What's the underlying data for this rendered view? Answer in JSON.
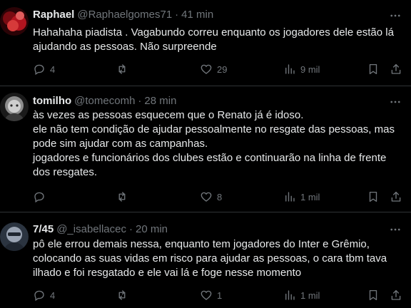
{
  "tweets": [
    {
      "name": "Raphael",
      "handle": "@Raphaelgomes71",
      "time": "41 min",
      "lines": [
        "Hahahaha piadista . Vagabundo correu enquanto os jogadores dele estão lá",
        "ajudando as pessoas. Não surpreende"
      ],
      "replies": "4",
      "reposts": "",
      "likes": "29",
      "views": "9 mil",
      "avatar_colors": [
        "#7a0b12",
        "#d63a3a"
      ]
    },
    {
      "name": "tomilho",
      "handle": "@tomecomh",
      "time": "28 min",
      "lines": [
        "às vezes as pessoas esquecem que o Renato já é idoso.",
        "ele não tem condição de ajudar pessoalmente no resgate das pessoas, mas",
        "pode sim ajudar com as campanhas.",
        "jogadores e funcionários dos clubes estão e continuarão na linha de frente",
        "dos resgates."
      ],
      "replies": "",
      "reposts": "",
      "likes": "8",
      "views": "1 mil",
      "avatar_colors": [
        "#cfcfcf",
        "#3a3a3a"
      ]
    },
    {
      "name": "7/45",
      "handle": "@_isabellacec",
      "time": "20 min",
      "lines": [
        "pô ele errou demais nessa, enquanto tem jogadores do Inter e Grêmio,",
        "colocando as suas vidas em risco para ajudar as pessoas, o cara tbm tava",
        "ilhado e foi resgatado e ele vai lá e foge nesse momento"
      ],
      "replies": "4",
      "reposts": "",
      "likes": "1",
      "views": "1 mil",
      "avatar_colors": [
        "#9aa4b3",
        "#1f2630"
      ]
    }
  ],
  "colors": {
    "background": "#000000",
    "text": "#e7e9ea",
    "secondary": "#71767b",
    "divider": "#2f3336"
  },
  "icons": {
    "reply": "speech-bubble-icon",
    "repost": "repost-icon",
    "like": "heart-icon",
    "views": "bar-chart-icon",
    "bookmark": "bookmark-icon",
    "share": "share-icon",
    "more": "more-dots-icon"
  }
}
